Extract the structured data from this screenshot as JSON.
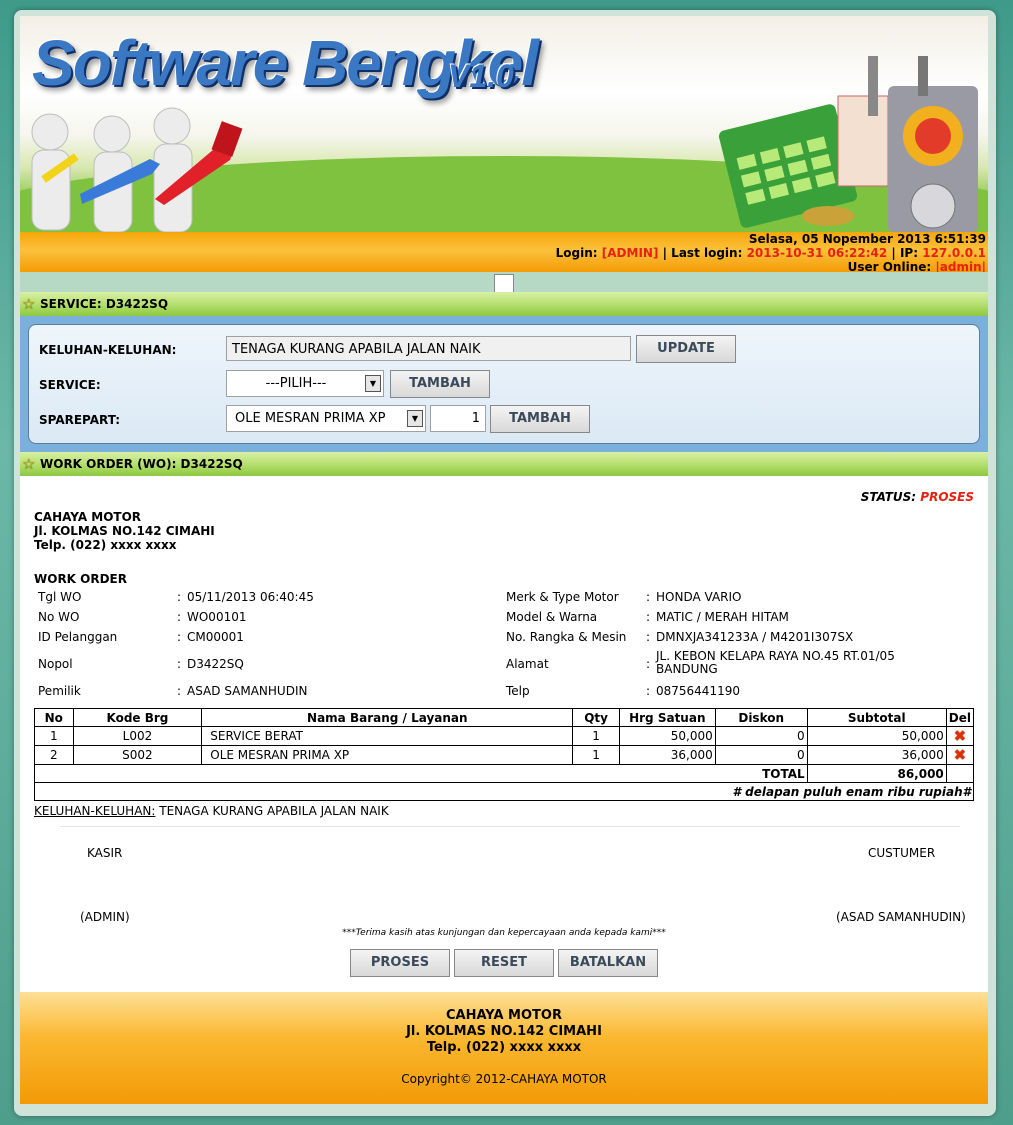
{
  "header": {
    "logo_title": "Software Bengkel",
    "logo_version": "V1.0",
    "datetime": "Selasa, 05 Nopember 2013 6:51:39",
    "login_label": "Login:",
    "login_user": "[ADMIN]",
    "last_login_label": "| Last login:",
    "last_login_value": "2013-10-31 06:22:42",
    "ip_label": "| IP:",
    "ip_value": "127.0.0.1",
    "online_label": "User Online:",
    "online_value": "|admin|"
  },
  "service_section": {
    "title": "SERVICE: D3422SQ",
    "keluhan_label": "KELUHAN-KELUHAN:",
    "keluhan_value": "TENAGA KURANG APABILA JALAN NAIK",
    "update_button": "UPDATE",
    "service_label": "SERVICE:",
    "service_select": "---PILIH---",
    "service_add_button": "TAMBAH",
    "sparepart_label": "SPAREPART:",
    "sparepart_select": "OLE MESRAN PRIMA XP",
    "sparepart_qty": "1",
    "sparepart_add_button": "TAMBAH"
  },
  "work_order_section": {
    "title": "WORK ORDER (WO): D3422SQ",
    "status_label": "STATUS:",
    "status_value": "PROSES",
    "company_name": "CAHAYA MOTOR",
    "company_address": "Jl. KOLMAS NO.142 CIMAHI",
    "company_phone": "Telp. (022) xxxx xxxx",
    "heading": "WORK ORDER",
    "left_fields": [
      {
        "label": "Tgl WO",
        "value": "05/11/2013 06:40:45"
      },
      {
        "label": "No WO",
        "value": "WO00101"
      },
      {
        "label": "ID Pelanggan",
        "value": "CM00001"
      },
      {
        "label": "Nopol",
        "value": "D3422SQ"
      },
      {
        "label": "Pemilik",
        "value": "ASAD SAMANHUDIN"
      }
    ],
    "right_fields": [
      {
        "label": "Merk & Type Motor",
        "value": "HONDA VARIO"
      },
      {
        "label": "Model & Warna",
        "value": "MATIC / MERAH HITAM"
      },
      {
        "label": "No. Rangka & Mesin",
        "value": "DMNXJA341233A / M4201I307SX"
      },
      {
        "label": "Alamat",
        "value": "JL. KEBON KELAPA RAYA NO.45 RT.01/05",
        "value2": "BANDUNG"
      },
      {
        "label": "Telp",
        "value": "08756441190"
      }
    ],
    "colon": ":",
    "table": {
      "headers": [
        "No",
        "Kode Brg",
        "Nama Barang / Layanan",
        "Qty",
        "Hrg Satuan",
        "Diskon",
        "Subtotal",
        "Del"
      ],
      "rows": [
        {
          "no": "1",
          "kode": "L002",
          "nama": "SERVICE BERAT",
          "qty": "1",
          "harga": "50,000",
          "diskon": "0",
          "subtotal": "50,000"
        },
        {
          "no": "2",
          "kode": "S002",
          "nama": "OLE MESRAN PRIMA XP",
          "qty": "1",
          "harga": "36,000",
          "diskon": "0",
          "subtotal": "36,000"
        }
      ],
      "total_label": "TOTAL",
      "total_value": "86,000",
      "terbilang": "# delapan puluh enam ribu rupiah#"
    },
    "keluhan_label": "KELUHAN-KELUHAN:",
    "keluhan_value": "TENAGA KURANG APABILA JALAN NAIK",
    "kasir_label": "KASIR",
    "customer_label": "CUSTUMER",
    "kasir_name": "(ADMIN)",
    "customer_name": "(ASAD SAMANHUDIN)",
    "thanks_note": "***Terima kasih atas kunjungan dan kepercayaan anda kepada kami***",
    "buttons": {
      "proses": "PROSES",
      "reset": "RESET",
      "batalkan": "BATALKAN"
    }
  },
  "footer": {
    "company_name": "CAHAYA MOTOR",
    "address": "Jl. KOLMAS NO.142 CIMAHI",
    "phone": "Telp. (022) xxxx xxxx",
    "copyright": "Copyright© 2012-CAHAYA MOTOR"
  },
  "colors": {
    "accent_red": "#e8210e",
    "orange_bar": "#f7a60a",
    "green_header": "#b6e070",
    "panel_blue": "#7ab0db"
  }
}
